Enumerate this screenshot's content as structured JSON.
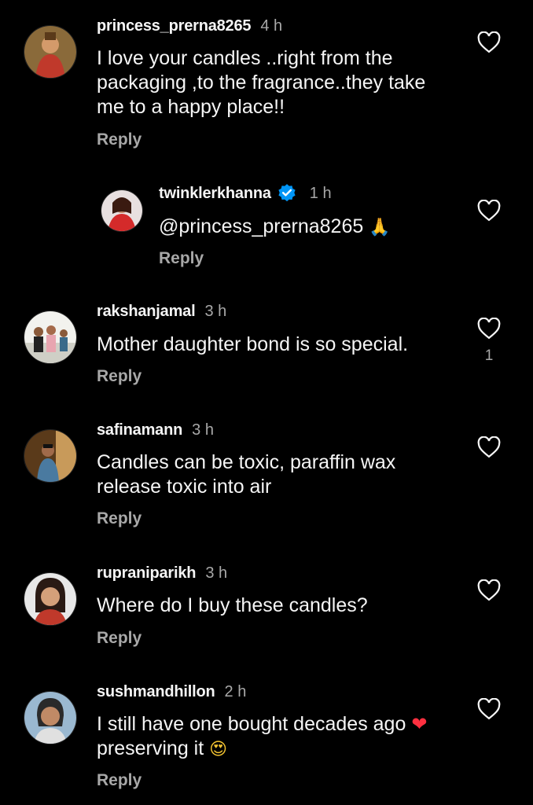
{
  "comments": [
    {
      "username": "princess_prerna8265",
      "time": "4 h",
      "text_lines": [
        "I love your candles ..right from the",
        "packaging ,to the fragrance..they take",
        "me to a happy place!!"
      ],
      "reply_label": "Reply",
      "likes": ""
    },
    {
      "username": "twinklerkhanna",
      "verified": true,
      "time": "1 h",
      "text": "@princess_prerna8265",
      "emoji": "🙏",
      "reply_label": "Reply",
      "likes": ""
    },
    {
      "username": "rakshanjamal",
      "time": "3 h",
      "text": "Mother daughter bond is so special.",
      "reply_label": "Reply",
      "likes": "1"
    },
    {
      "username": "safinamann",
      "time": "3 h",
      "text_lines": [
        "Candles can be toxic, paraffin wax",
        "release toxic into air"
      ],
      "reply_label": "Reply",
      "likes": ""
    },
    {
      "username": "rupraniparikh",
      "time": "3 h",
      "text": "Where do I buy these candles?",
      "reply_label": "Reply",
      "likes": ""
    },
    {
      "username": "sushmandhillon",
      "time": "2 h",
      "text_line1": "I still have one bought decades ago",
      "emoji1": "❤",
      "text_line2": "preserving it",
      "emoji2": "😍",
      "reply_label": "Reply",
      "likes": ""
    }
  ],
  "colors": {
    "background": "#000000",
    "primary_text": "#f5f5f5",
    "secondary_text": "#a8a8a8",
    "verified": "#0095f6",
    "heart_emoji": "#ff3040"
  },
  "icons": {
    "like": "heart-outline-icon",
    "verified": "verified-badge-icon"
  }
}
